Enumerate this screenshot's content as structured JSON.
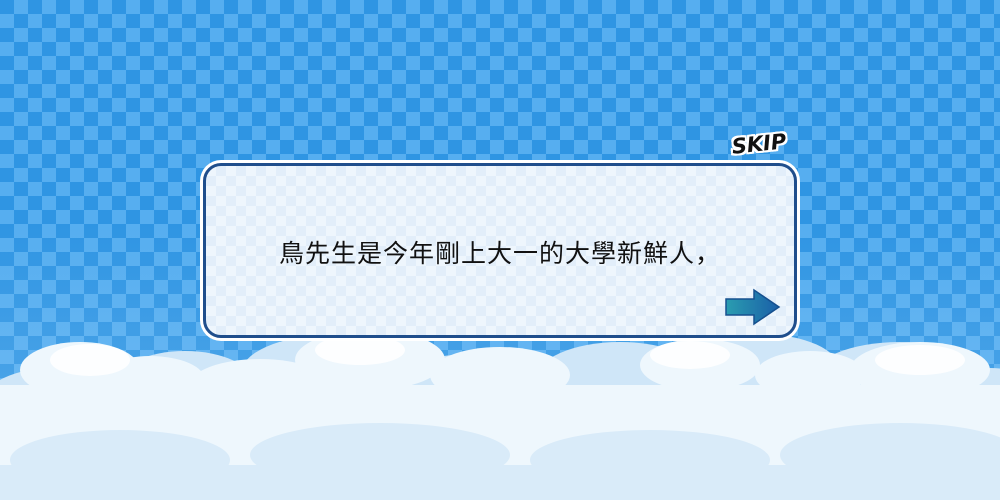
{
  "dialog": {
    "text": "鳥先生是今年剛上大一的大學新鮮人，"
  },
  "skip": {
    "label": "SKIP"
  },
  "icons": {
    "next": "right-arrow-icon"
  },
  "colors": {
    "sky": "#2f95e3",
    "sky_check": "#56aef0",
    "dialog_border": "#1f4e8c",
    "dialog_bg": "#eef6fd",
    "arrow": "#1b75b8",
    "cloud": "#e6f3fc"
  }
}
